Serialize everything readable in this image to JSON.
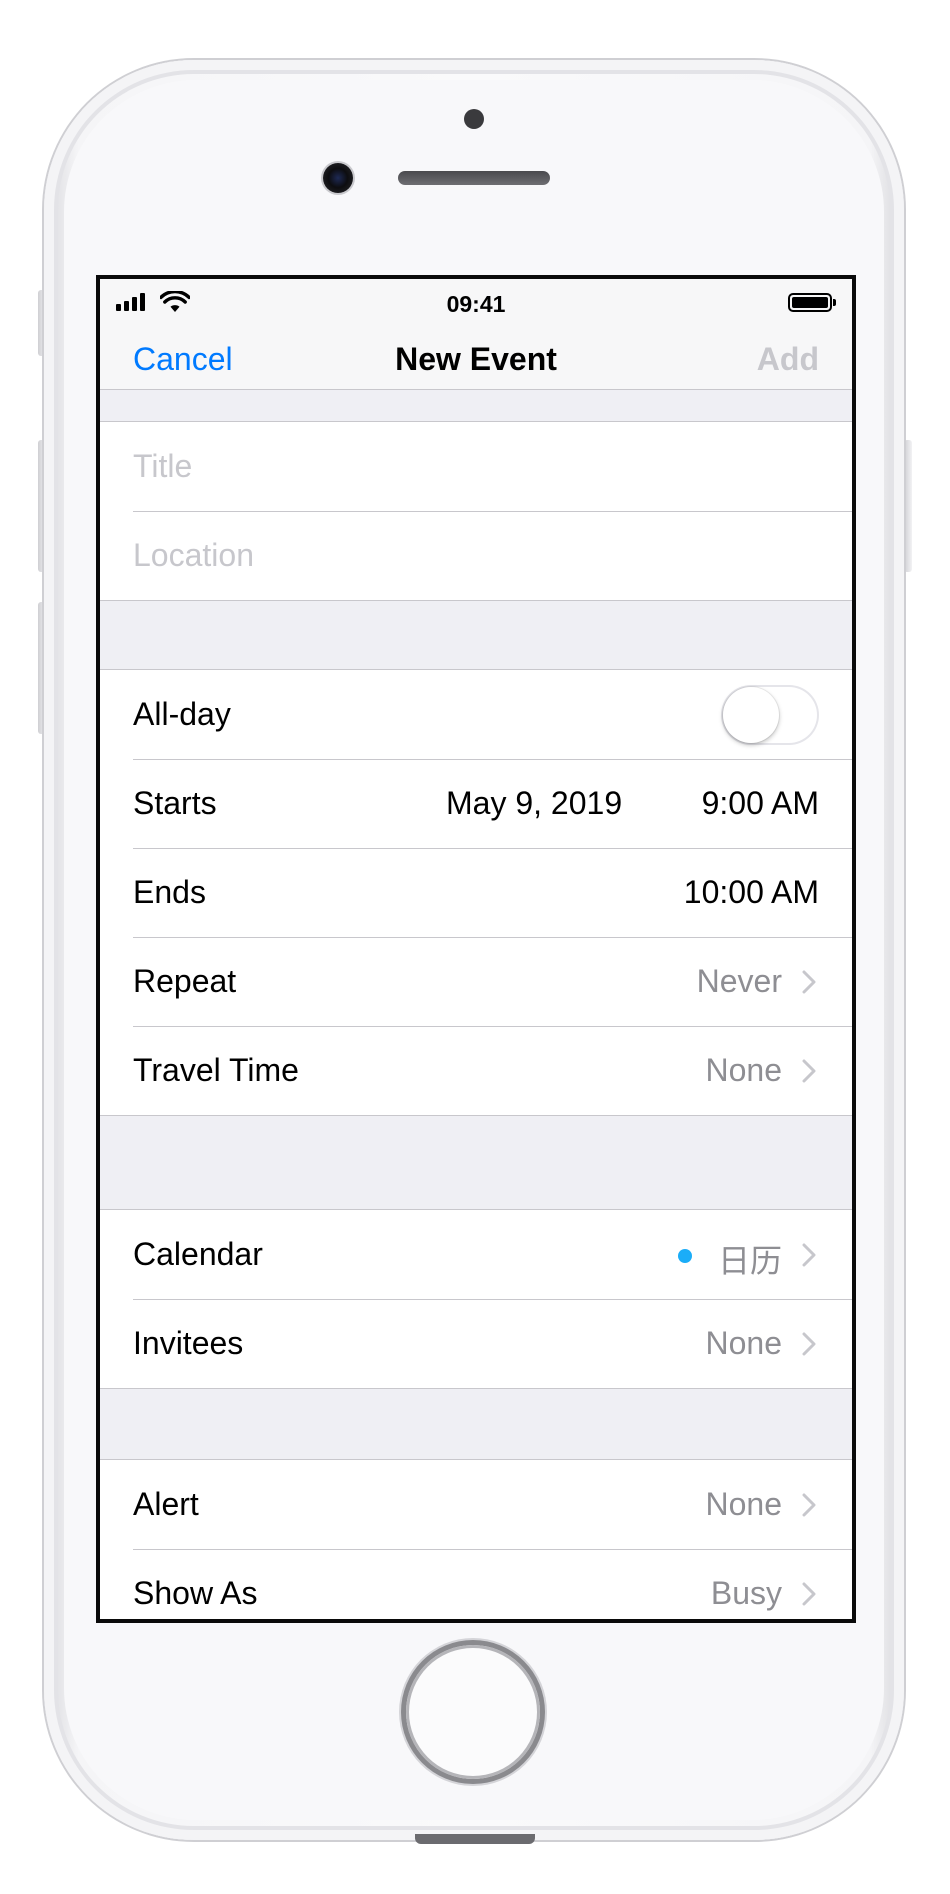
{
  "status_bar": {
    "time": "09:41"
  },
  "nav": {
    "cancel_label": "Cancel",
    "title": "New Event",
    "add_label": "Add"
  },
  "fields": {
    "title_placeholder": "Title",
    "location_placeholder": "Location"
  },
  "schedule": {
    "allday_label": "All-day",
    "allday_on": false,
    "starts_label": "Starts",
    "starts_date": "May 9, 2019",
    "starts_time": "9:00 AM",
    "ends_label": "Ends",
    "ends_time": "10:00 AM",
    "repeat_label": "Repeat",
    "repeat_value": "Never",
    "travel_label": "Travel Time",
    "travel_value": "None"
  },
  "calendar_group": {
    "calendar_label": "Calendar",
    "calendar_value": "日历",
    "calendar_color": "#1badf8",
    "invitees_label": "Invitees",
    "invitees_value": "None"
  },
  "alert_group": {
    "alert_label": "Alert",
    "alert_value": "None",
    "showas_label": "Show As",
    "showas_value": "Busy"
  },
  "colors": {
    "accent": "#007aff",
    "disabled": "#c7c7cc",
    "secondary_text": "#8e8e93",
    "group_background": "#efeff4"
  },
  "icons": [
    "cellular-signal-icon",
    "wifi-icon",
    "battery-icon",
    "chevron-right-icon"
  ]
}
